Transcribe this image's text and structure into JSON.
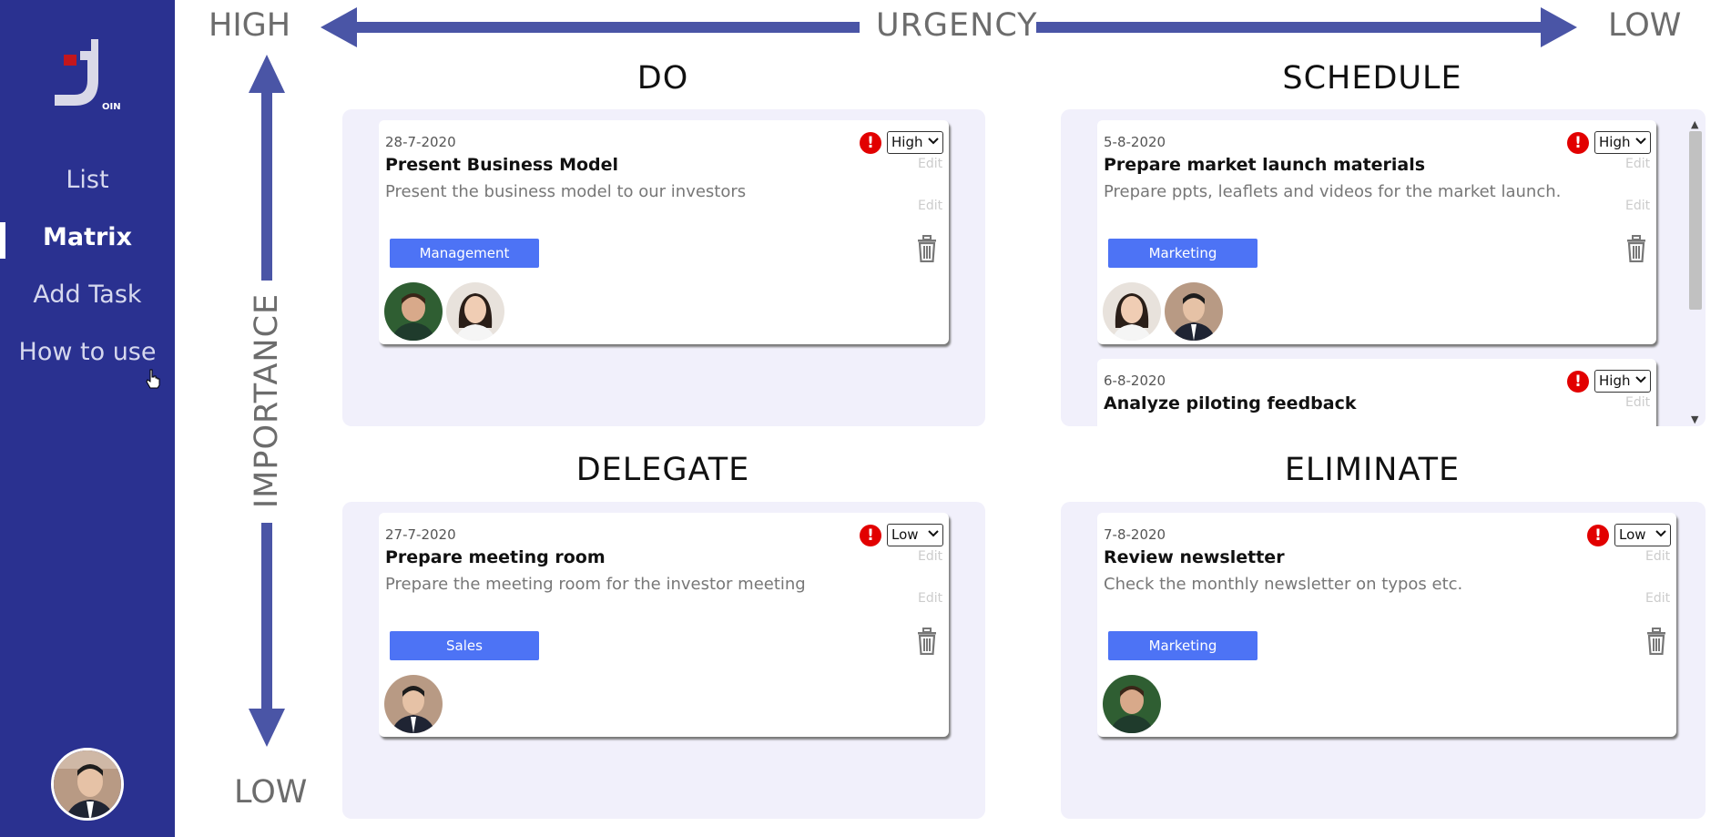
{
  "sidebar": {
    "logo_text": "OIN",
    "items": [
      {
        "label": "List"
      },
      {
        "label": "Matrix"
      },
      {
        "label": "Add Task"
      },
      {
        "label": "How to use"
      }
    ]
  },
  "axes": {
    "urgency_label": "URGENCY",
    "urgency_high": "HIGH",
    "urgency_low": "LOW",
    "importance_label": "IMPORTANCE",
    "importance_low": "LOW"
  },
  "quadrants": {
    "do": {
      "title": "DO",
      "cards": [
        {
          "date": "28-7-2020",
          "title": "Present Business Model",
          "description": "Present the business model to our investors",
          "priority": "High",
          "category": "Management",
          "edit": "Edit"
        }
      ]
    },
    "schedule": {
      "title": "SCHEDULE",
      "cards": [
        {
          "date": "5-8-2020",
          "title": "Prepare market launch materials",
          "description": "Prepare ppts, leaflets and videos for the market launch.",
          "priority": "High",
          "category": "Marketing",
          "edit": "Edit"
        },
        {
          "date": "6-8-2020",
          "title": "Analyze piloting feedback",
          "priority": "High",
          "edit": "Edit"
        }
      ]
    },
    "delegate": {
      "title": "DELEGATE",
      "cards": [
        {
          "date": "27-7-2020",
          "title": "Prepare meeting room",
          "description": "Prepare the meeting room for the investor meeting",
          "priority": "Low",
          "category": "Sales",
          "edit": "Edit"
        }
      ]
    },
    "eliminate": {
      "title": "ELIMINATE",
      "cards": [
        {
          "date": "7-8-2020",
          "title": "Review newsletter",
          "description": "Check the monthly newsletter on typos etc.",
          "priority": "Low",
          "category": "Marketing",
          "edit": "Edit"
        }
      ]
    }
  },
  "icons": {
    "alert": "exclamation-circle-icon",
    "trash": "trash-icon",
    "chevron": "chevron-down-icon",
    "alert_glyph": "!"
  },
  "colors": {
    "sidebar": "#2a3190",
    "axis_arrow": "#4a55a6",
    "panel_bg": "#f1f0fb",
    "tag": "#4d73f5",
    "alert": "#e20000"
  }
}
